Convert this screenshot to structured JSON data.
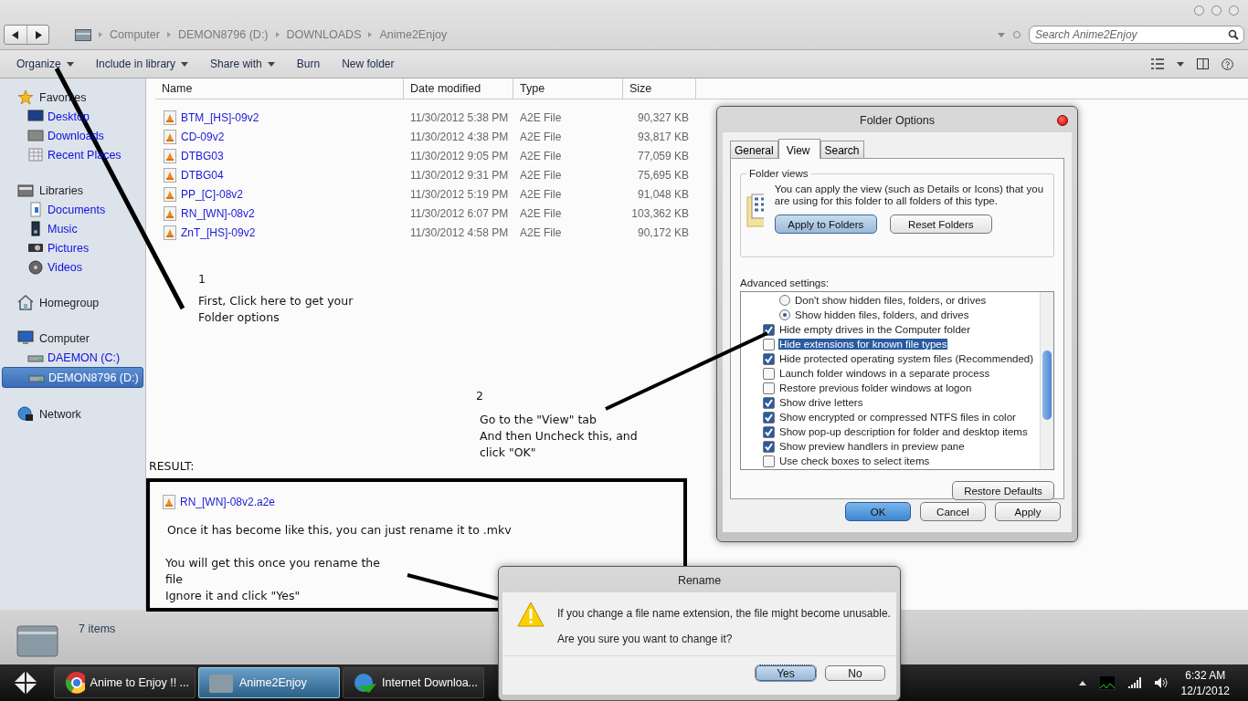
{
  "address": {
    "breadcrumb": [
      "Computer",
      "DEMON8796 (D:)",
      "DOWNLOADS",
      "Anime2Enjoy"
    ],
    "search": {
      "placeholder": "Search Anime2Enjoy"
    }
  },
  "toolbar": [
    {
      "label": "Organize",
      "dropdown": true
    },
    {
      "label": "Include in library",
      "dropdown": true
    },
    {
      "label": "Share with",
      "dropdown": true
    },
    {
      "label": "Burn",
      "dropdown": false
    },
    {
      "label": "New folder",
      "dropdown": false
    }
  ],
  "sidebar": [
    {
      "label": "Favorites",
      "children": [
        {
          "label": "Desktop",
          "selected": false
        },
        {
          "label": "Downloads",
          "selected": false
        },
        {
          "label": "Recent Places",
          "selected": false
        }
      ]
    },
    {
      "label": "Libraries",
      "children": [
        {
          "label": "Documents",
          "selected": false
        },
        {
          "label": "Music",
          "selected": false
        },
        {
          "label": "Pictures",
          "selected": false
        },
        {
          "label": "Videos",
          "selected": false
        }
      ]
    },
    {
      "label": "Homegroup"
    },
    {
      "label": "Computer",
      "children": [
        {
          "label": "DAEMON (C:)",
          "selected": false
        },
        {
          "label": "DEMON8796 (D:)",
          "selected": true
        }
      ]
    },
    {
      "label": "Network"
    }
  ],
  "file_list": {
    "columns": [
      "Name",
      "Date modified",
      "Type",
      "Size"
    ],
    "rows": [
      {
        "name": "BTM_[HS]-09v2",
        "date": "11/30/2012 5:38 PM",
        "type": "A2E File",
        "size": "90,327 KB"
      },
      {
        "name": "CD-09v2",
        "date": "11/30/2012 4:38 PM",
        "type": "A2E File",
        "size": "93,817 KB"
      },
      {
        "name": "DTBG03",
        "date": "11/30/2012 9:05 PM",
        "type": "A2E File",
        "size": "77,059 KB"
      },
      {
        "name": "DTBG04",
        "date": "11/30/2012 9:31 PM",
        "type": "A2E File",
        "size": "75,695 KB"
      },
      {
        "name": "PP_[C]-08v2",
        "date": "11/30/2012 5:19 PM",
        "type": "A2E File",
        "size": "91,048 KB"
      },
      {
        "name": "RN_[WN]-08v2",
        "date": "11/30/2012 6:07 PM",
        "type": "A2E File",
        "size": "103,362 KB"
      },
      {
        "name": "ZnT_[HS]-09v2",
        "date": "11/30/2012 4:58 PM",
        "type": "A2E File",
        "size": "90,172 KB"
      }
    ]
  },
  "annotations": {
    "step1": {
      "number": "1",
      "text": "First, Click here to get your Folder options"
    },
    "step2": {
      "number": "2",
      "line1": "Go to the \"View\" tab",
      "text": "And then Uncheck this, and click \"OK\""
    },
    "result_label": "RESULT:",
    "result": {
      "file": "RN_[WN]-08v2.a2e",
      "note": "Once it has become like this, you can just rename it to .mkv",
      "note2": "You will get this once you rename the file",
      "note3": "Ignore it and click \"Yes\""
    }
  },
  "folder_options": {
    "title": "Folder Options",
    "tabs": [
      {
        "label": "General",
        "selected": false
      },
      {
        "label": "View",
        "selected": true
      },
      {
        "label": "Search",
        "selected": false
      }
    ],
    "folder_views": {
      "legend": "Folder views",
      "description": "You can apply the view (such as Details or Icons) that you are using for this folder to all folders of this type.",
      "buttons": [
        {
          "label": "Apply to Folders",
          "focused": true
        },
        {
          "label": "Reset Folders",
          "focused": false
        }
      ]
    },
    "advanced_label": "Advanced settings:",
    "settings": [
      {
        "kind": "radio",
        "label": "Don't show hidden files, folders, or drives",
        "checked": false,
        "selected": false
      },
      {
        "kind": "radio",
        "label": "Show hidden files, folders, and drives",
        "checked": true,
        "selected": false
      },
      {
        "kind": "checkbox",
        "label": "Hide empty drives in the Computer folder",
        "checked": true,
        "selected": false
      },
      {
        "kind": "checkbox",
        "label": "Hide extensions for known file types",
        "checked": false,
        "selected": true
      },
      {
        "kind": "checkbox",
        "label": "Hide protected operating system files (Recommended)",
        "checked": true,
        "selected": false
      },
      {
        "kind": "checkbox",
        "label": "Launch folder windows in a separate process",
        "checked": false,
        "selected": false
      },
      {
        "kind": "checkbox",
        "label": "Restore previous folder windows at logon",
        "checked": false,
        "selected": false
      },
      {
        "kind": "checkbox",
        "label": "Show drive letters",
        "checked": true,
        "selected": false
      },
      {
        "kind": "checkbox",
        "label": "Show encrypted or compressed NTFS files in color",
        "checked": true,
        "selected": false
      },
      {
        "kind": "checkbox",
        "label": "Show pop-up description for folder and desktop items",
        "checked": true,
        "selected": false
      },
      {
        "kind": "checkbox",
        "label": "Show preview handlers in preview pane",
        "checked": true,
        "selected": false
      },
      {
        "kind": "checkbox",
        "label": "Use check boxes to select items",
        "checked": false,
        "selected": false
      }
    ],
    "restore_button": "Restore Defaults",
    "buttons": [
      {
        "label": "OK",
        "focused": true
      },
      {
        "label": "Cancel",
        "focused": false
      },
      {
        "label": "Apply",
        "focused": false
      }
    ]
  },
  "rename_dialog": {
    "title": "Rename",
    "message": "If you change a file name extension, the file might become unusable.",
    "question": "Are you sure you want to change it?",
    "buttons": [
      {
        "label": "Yes",
        "focused": true
      },
      {
        "label": "No",
        "focused": false
      }
    ]
  },
  "status_bar": {
    "count": "7 items"
  },
  "taskbar": {
    "items": [
      {
        "label": "Anime to Enjoy !! ...",
        "selected": false
      },
      {
        "label": "Anime2Enjoy",
        "selected": true
      },
      {
        "label": "Internet Downloa...",
        "selected": false
      }
    ],
    "time": "6:32 AM",
    "date": "12/1/2012"
  }
}
